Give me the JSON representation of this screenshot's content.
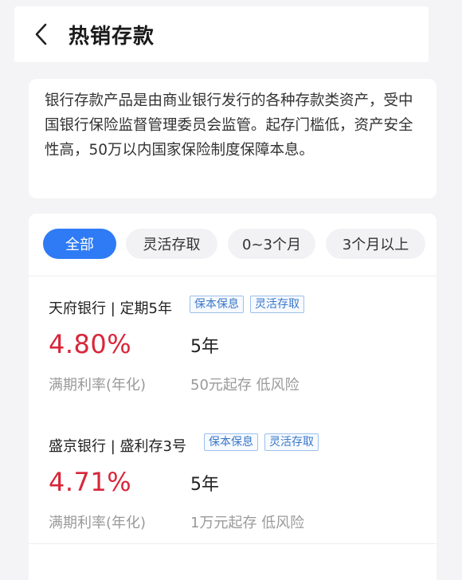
{
  "header": {
    "back_icon": "chevron-left-icon",
    "title": "热销存款"
  },
  "intro": {
    "text": "银行存款产品是由商业银行发行的各种存款类资产，受中国银行保险监督管理委员会监管。起存门槛低，资产安全性高，50万以内国家保险制度保障本息。"
  },
  "tabs": [
    {
      "label": "全部",
      "active": true
    },
    {
      "label": "灵活存取",
      "active": false
    },
    {
      "label": "0~3个月",
      "active": false
    },
    {
      "label": "3个月以上",
      "active": false
    }
  ],
  "products": [
    {
      "name": "天府银行 | 定期5年",
      "tags": [
        "保本保息",
        "灵活存取"
      ],
      "rate": "4.80%",
      "rate_label": "满期利率(年化)",
      "term": "5年",
      "term_sub": "50元起存 低风险"
    },
    {
      "name": "盛京银行 | 盛利存3号",
      "tags": [
        "保本保息",
        "灵活存取"
      ],
      "rate": "4.71%",
      "rate_label": "满期利率(年化)",
      "term": "5年",
      "term_sub": "1万元起存 低风险"
    }
  ],
  "colors": {
    "accent": "#2f7bf5",
    "rate": "#d8263a",
    "tag_border": "#9cc0ec",
    "tag_text": "#3a78c8",
    "background": "#f4f4f6"
  }
}
